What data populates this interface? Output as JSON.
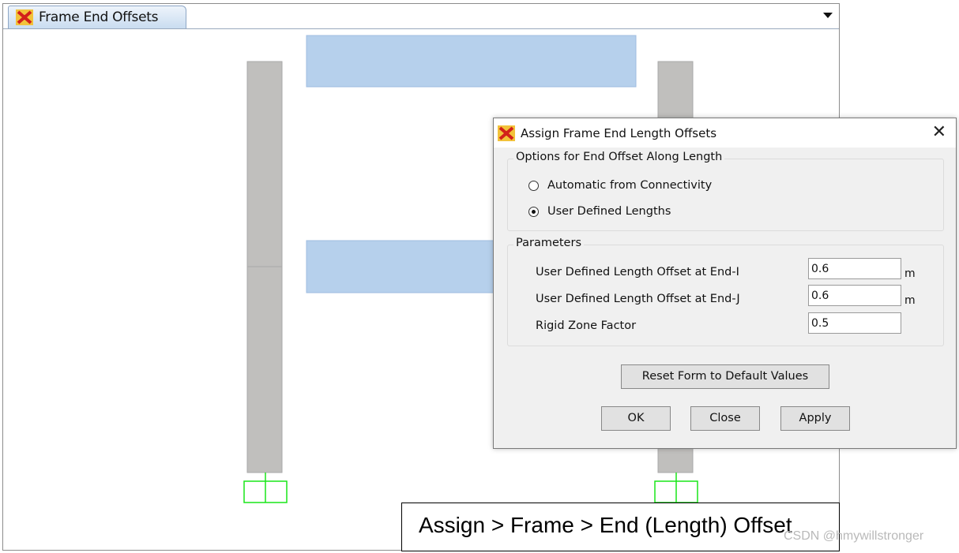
{
  "tab": {
    "title": "Frame End Offsets",
    "icon": "sap-app-icon"
  },
  "dialog": {
    "title": "Assign Frame End Length Offsets",
    "options_group": {
      "title": "Options for End Offset Along Length",
      "radios": [
        {
          "label": "Automatic from Connectivity",
          "checked": false
        },
        {
          "label": "User Defined Lengths",
          "checked": true
        }
      ]
    },
    "parameters_group": {
      "title": "Parameters",
      "rows": [
        {
          "label": "User Defined Length Offset at End-I",
          "value": "0.6",
          "unit": "m"
        },
        {
          "label": "User Defined Length Offset at End-J",
          "value": "0.6",
          "unit": "m"
        },
        {
          "label": "Rigid Zone Factor",
          "value": "0.5",
          "unit": ""
        }
      ]
    },
    "reset_button": "Reset Form to Default Values",
    "ok_button": "OK",
    "close_button": "Close",
    "apply_button": "Apply"
  },
  "caption": "Assign > Frame > End (Length) Offset",
  "watermark": "CSDN @hmywillstronger",
  "colors": {
    "column_fill": "#c0bfbd",
    "beam_fill": "#b6d0ec",
    "support": "#19e619"
  }
}
